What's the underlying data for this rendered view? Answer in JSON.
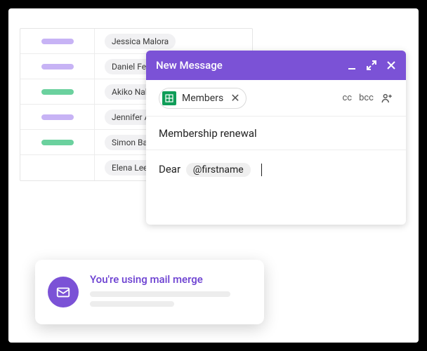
{
  "table": {
    "rows": [
      {
        "color": "purple",
        "name": "Jessica Malora"
      },
      {
        "color": "purple",
        "name": "Daniel Ferr"
      },
      {
        "color": "green",
        "name": "Akiko Naka"
      },
      {
        "color": "purple",
        "name": "Jennifer Ac"
      },
      {
        "color": "green",
        "name": "Simon Balli"
      },
      {
        "color": "",
        "name": "Elena Lee"
      }
    ]
  },
  "composer": {
    "title": "New Message",
    "recipient_tag": "Members",
    "cc": "cc",
    "bcc": "bcc",
    "subject": "Membership renewal",
    "greeting": "Dear",
    "token": "@firstname"
  },
  "toast": {
    "title": "You're using mail merge"
  }
}
